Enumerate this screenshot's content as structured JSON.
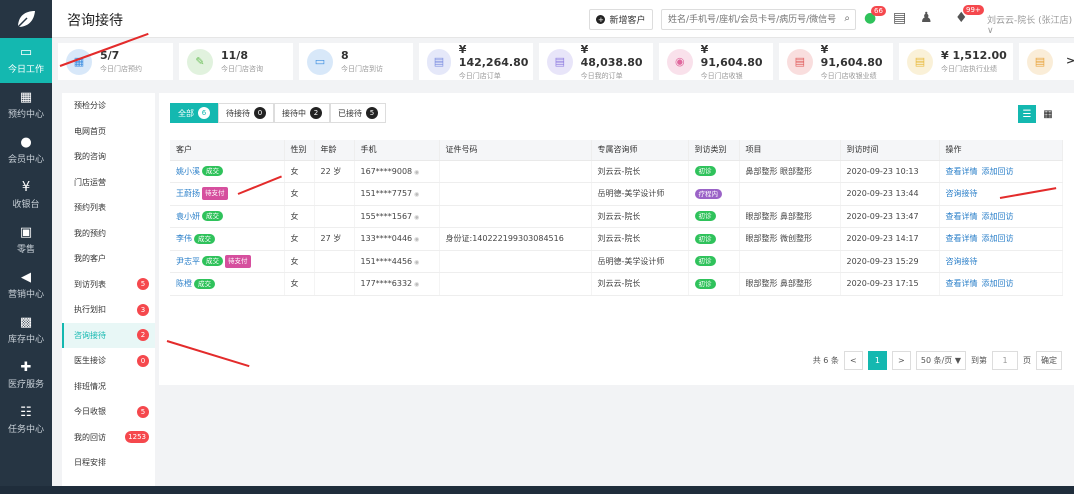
{
  "page_title": "咨询接待",
  "new_customer_label": "新增客户",
  "search_placeholder": "姓名/手机号/座机/会员卡号/病历号/微信号",
  "notif": {
    "wechat": "66",
    "bell": "99+"
  },
  "user_label": "刘云云-院长 (张江店) ∨",
  "left_nav": [
    {
      "label": "今日工作",
      "icon": "▭",
      "active": true
    },
    {
      "label": "预约中心",
      "icon": "▦",
      "active": false
    },
    {
      "label": "会员中心",
      "icon": "●",
      "active": false
    },
    {
      "label": "收银台",
      "icon": "¥",
      "active": false
    },
    {
      "label": "零售",
      "icon": "▣",
      "active": false
    },
    {
      "label": "营销中心",
      "icon": "◀",
      "active": false
    },
    {
      "label": "库存中心",
      "icon": "▩",
      "active": false
    },
    {
      "label": "医疗服务",
      "icon": "✚",
      "active": false
    },
    {
      "label": "任务中心",
      "icon": "☷",
      "active": false
    }
  ],
  "stats": [
    {
      "value": "5/7",
      "label": "今日门店预约",
      "color": "#3b8de0",
      "icon": "▦"
    },
    {
      "value": "11/8",
      "label": "今日门店咨询",
      "color": "#6bbf59",
      "icon": "✎"
    },
    {
      "value": "8",
      "label": "今日门店到访",
      "color": "#3b8de0",
      "icon": "▭"
    },
    {
      "value": "¥ 142,264.80",
      "label": "今日门店订单",
      "color": "#7b8de0",
      "icon": "▤"
    },
    {
      "value": "¥ 48,038.80",
      "label": "今日我的订单",
      "color": "#8e7be0",
      "icon": "▤"
    },
    {
      "value": "¥ 91,604.80",
      "label": "今日门店收银",
      "color": "#e0679d",
      "icon": "◉"
    },
    {
      "value": "¥ 91,604.80",
      "label": "今日门店收银业绩",
      "color": "#e05b5b",
      "icon": "▤"
    },
    {
      "value": "¥ 1,512.00",
      "label": "今日门店执行业绩",
      "color": "#e8b93b",
      "icon": "▤"
    },
    {
      "value": "",
      "label": "",
      "color": "#e8a33b",
      "icon": "▤"
    }
  ],
  "side_nav": [
    {
      "label": "预检分诊",
      "badge": ""
    },
    {
      "label": "电网首页",
      "badge": ""
    },
    {
      "label": "我的咨询",
      "badge": ""
    },
    {
      "label": "门店运营",
      "badge": ""
    },
    {
      "label": "预约列表",
      "badge": ""
    },
    {
      "label": "我的预约",
      "badge": ""
    },
    {
      "label": "我的客户",
      "badge": ""
    },
    {
      "label": "到访列表",
      "badge": "5"
    },
    {
      "label": "执行划扣",
      "badge": "3"
    },
    {
      "label": "咨询接待",
      "badge": "2",
      "active": true
    },
    {
      "label": "医生接诊",
      "badge": "0"
    },
    {
      "label": "排班情况",
      "badge": ""
    },
    {
      "label": "今日收银",
      "badge": "5"
    },
    {
      "label": "我的回访",
      "badge": "1253"
    },
    {
      "label": "日程安排",
      "badge": ""
    }
  ],
  "tabs": [
    {
      "label": "全部",
      "count": "6",
      "active": true
    },
    {
      "label": "待接待",
      "count": "0"
    },
    {
      "label": "接待中",
      "count": "2"
    },
    {
      "label": "已接待",
      "count": "5"
    }
  ],
  "columns": [
    "客户",
    "性别",
    "年龄",
    "手机",
    "证件号码",
    "专属咨询师",
    "到访类别",
    "项目",
    "到访时间",
    "操作"
  ],
  "rows": [
    {
      "name": "姚小溪",
      "tags": [
        {
          "t": "成交",
          "c": "tg"
        }
      ],
      "gender": "女",
      "age": "22 岁",
      "phone": "167****9008",
      "id": "",
      "consultant": "刘云云-院长",
      "visit": {
        "t": "初诊",
        "c": "tg"
      },
      "project": "鼻部整形 眼部整形",
      "time": "2020-09-23 10:13",
      "ops": [
        "查看详情",
        "添加回访"
      ]
    },
    {
      "name": "王蔚扬",
      "tags": [
        {
          "t": "待支付",
          "c": "tp"
        }
      ],
      "gender": "女",
      "age": "",
      "phone": "151****7757",
      "id": "",
      "consultant": "岳明德-美学设计师",
      "visit": {
        "t": "疗程内",
        "c": "tv"
      },
      "project": "",
      "time": "2020-09-23 13:44",
      "ops": [
        "咨询接待"
      ]
    },
    {
      "name": "袁小妍",
      "tags": [
        {
          "t": "成交",
          "c": "tg"
        }
      ],
      "gender": "女",
      "age": "",
      "phone": "155****1567",
      "id": "",
      "consultant": "刘云云-院长",
      "visit": {
        "t": "初诊",
        "c": "tg"
      },
      "project": "眼部整形 鼻部整形",
      "time": "2020-09-23 13:47",
      "ops": [
        "查看详情",
        "添加回访"
      ]
    },
    {
      "name": "李伟",
      "tags": [
        {
          "t": "成交",
          "c": "tg"
        }
      ],
      "gender": "女",
      "age": "27 岁",
      "phone": "133****0446",
      "id": "身份证:140222199303084516",
      "consultant": "刘云云-院长",
      "visit": {
        "t": "初诊",
        "c": "tg"
      },
      "project": "眼部整形 微创整形",
      "time": "2020-09-23 14:17",
      "ops": [
        "查看详情",
        "添加回访"
      ]
    },
    {
      "name": "尹志平",
      "tags": [
        {
          "t": "成交",
          "c": "tg"
        },
        {
          "t": "待支付",
          "c": "tp"
        }
      ],
      "gender": "女",
      "age": "",
      "phone": "151****4456",
      "id": "",
      "consultant": "岳明德-美学设计师",
      "visit": {
        "t": "初诊",
        "c": "tg"
      },
      "project": "",
      "time": "2020-09-23 15:29",
      "ops": [
        "咨询接待"
      ]
    },
    {
      "name": "陈橙",
      "tags": [
        {
          "t": "成交",
          "c": "tg"
        }
      ],
      "gender": "女",
      "age": "",
      "phone": "177****6332",
      "id": "",
      "consultant": "刘云云-院长",
      "visit": {
        "t": "初诊",
        "c": "tg"
      },
      "project": "眼部整形 鼻部整形",
      "time": "2020-09-23 17:15",
      "ops": [
        "查看详情",
        "添加回访"
      ]
    }
  ],
  "pager": {
    "total": "共 6 条",
    "prev": "<",
    "page": "1",
    "next": ">",
    "size": "50 条/页 ▼",
    "goto": "到第",
    "goto_val": "1",
    "unit": "页",
    "confirm": "确定"
  }
}
